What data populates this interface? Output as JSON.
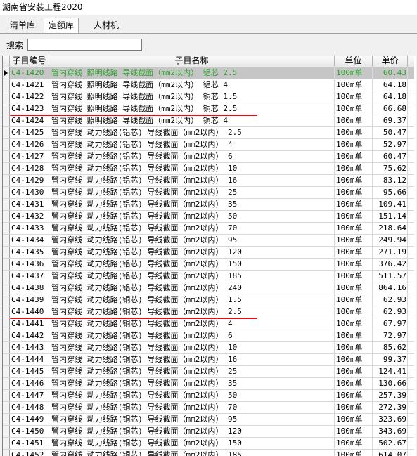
{
  "window": {
    "title": "湖南省安装工程2020"
  },
  "tabs": [
    {
      "label": "清单库",
      "active": false
    },
    {
      "label": "定额库",
      "active": true
    },
    {
      "label": "人材机",
      "active": false
    }
  ],
  "search": {
    "label": "搜索",
    "value": "",
    "placeholder": ""
  },
  "table": {
    "columns": [
      "子目编号",
      "子目名称",
      "单位",
      "单价"
    ],
    "selected_index": 0,
    "rows": [
      {
        "code": "C4-1420",
        "name": "管内穿线  照明线路  导线截面（mm2以内） 铝芯 2.5",
        "unit": "100m单",
        "price": "60.43"
      },
      {
        "code": "C4-1421",
        "name": "管内穿线  照明线路  导线截面（mm2以内） 铝芯 4",
        "unit": "100m单",
        "price": "64.18"
      },
      {
        "code": "C4-1422",
        "name": "管内穿线  照明线路  导线截面（mm2以内） 铜芯 1.5",
        "unit": "100m单",
        "price": "64.18"
      },
      {
        "code": "C4-1423",
        "name": "管内穿线  照明线路  导线截面（mm2以内） 铜芯 2.5",
        "unit": "100m单",
        "price": "66.68"
      },
      {
        "code": "C4-1424",
        "name": "管内穿线  照明线路  导线截面（mm2以内） 铜芯 4",
        "unit": "100m单",
        "price": "69.37"
      },
      {
        "code": "C4-1425",
        "name": "管内穿线  动力线路(铝芯) 导线截面（mm2以内） 2.5",
        "unit": "100m单",
        "price": "50.47"
      },
      {
        "code": "C4-1426",
        "name": "管内穿线  动力线路(铝芯) 导线截面（mm2以内） 4",
        "unit": "100m单",
        "price": "52.97"
      },
      {
        "code": "C4-1427",
        "name": "管内穿线  动力线路(铝芯) 导线截面（mm2以内） 6",
        "unit": "100m单",
        "price": "60.47"
      },
      {
        "code": "C4-1428",
        "name": "管内穿线  动力线路(铝芯) 导线截面（mm2以内） 10",
        "unit": "100m单",
        "price": "75.62"
      },
      {
        "code": "C4-1429",
        "name": "管内穿线  动力线路(铝芯) 导线截面（mm2以内） 16",
        "unit": "100m单",
        "price": "83.12"
      },
      {
        "code": "C4-1430",
        "name": "管内穿线  动力线路(铝芯) 导线截面（mm2以内） 25",
        "unit": "100m单",
        "price": "95.66"
      },
      {
        "code": "C4-1431",
        "name": "管内穿线  动力线路(铝芯) 导线截面（mm2以内） 35",
        "unit": "100m单",
        "price": "109.41"
      },
      {
        "code": "C4-1432",
        "name": "管内穿线  动力线路(铝芯) 导线截面（mm2以内） 50",
        "unit": "100m单",
        "price": "151.14"
      },
      {
        "code": "C4-1433",
        "name": "管内穿线  动力线路(铝芯) 导线截面（mm2以内） 70",
        "unit": "100m单",
        "price": "218.64"
      },
      {
        "code": "C4-1434",
        "name": "管内穿线  动力线路(铝芯) 导线截面（mm2以内） 95",
        "unit": "100m单",
        "price": "249.94"
      },
      {
        "code": "C4-1435",
        "name": "管内穿线  动力线路(铝芯) 导线截面（mm2以内） 120",
        "unit": "100m单",
        "price": "271.19"
      },
      {
        "code": "C4-1436",
        "name": "管内穿线  动力线路(铝芯) 导线截面（mm2以内） 150",
        "unit": "100m单",
        "price": "376.42"
      },
      {
        "code": "C4-1437",
        "name": "管内穿线  动力线路(铝芯) 导线截面（mm2以内） 185",
        "unit": "100m单",
        "price": "511.57"
      },
      {
        "code": "C4-1438",
        "name": "管内穿线  动力线路(铝芯) 导线截面（mm2以内） 240",
        "unit": "100m单",
        "price": "864.16"
      },
      {
        "code": "C4-1439",
        "name": "管内穿线  动力线路(铜芯) 导线截面（mm2以内） 1.5",
        "unit": "100m单",
        "price": "62.93"
      },
      {
        "code": "C4-1440",
        "name": "管内穿线  动力线路(铜芯) 导线截面（mm2以内） 2.5",
        "unit": "100m单",
        "price": "62.93"
      },
      {
        "code": "C4-1441",
        "name": "管内穿线  动力线路(铜芯) 导线截面（mm2以内） 4",
        "unit": "100m单",
        "price": "67.97"
      },
      {
        "code": "C4-1442",
        "name": "管内穿线  动力线路(铜芯) 导线截面（mm2以内） 6",
        "unit": "100m单",
        "price": "72.97"
      },
      {
        "code": "C4-1443",
        "name": "管内穿线  动力线路(铜芯) 导线截面（mm2以内） 10",
        "unit": "100m单",
        "price": "85.62"
      },
      {
        "code": "C4-1444",
        "name": "管内穿线  动力线路(铜芯) 导线截面（mm2以内） 16",
        "unit": "100m单",
        "price": "99.37"
      },
      {
        "code": "C4-1445",
        "name": "管内穿线  动力线路(铜芯) 导线截面（mm2以内） 25",
        "unit": "100m单",
        "price": "124.41"
      },
      {
        "code": "C4-1446",
        "name": "管内穿线  动力线路(铜芯) 导线截面（mm2以内） 35",
        "unit": "100m单",
        "price": "130.66"
      },
      {
        "code": "C4-1447",
        "name": "管内穿线  动力线路(铜芯) 导线截面（mm2以内） 50",
        "unit": "100m单",
        "price": "257.39"
      },
      {
        "code": "C4-1448",
        "name": "管内穿线  动力线路(铜芯) 导线截面（mm2以内） 70",
        "unit": "100m单",
        "price": "272.39"
      },
      {
        "code": "C4-1449",
        "name": "管内穿线  动力线路(铜芯) 导线截面（mm2以内） 95",
        "unit": "100m单",
        "price": "323.69"
      },
      {
        "code": "C4-1450",
        "name": "管内穿线  动力线路(铜芯) 导线截面（mm2以内） 120",
        "unit": "100m单",
        "price": "343.69"
      },
      {
        "code": "C4-1451",
        "name": "管内穿线  动力线路(铜芯) 导线截面（mm2以内） 150",
        "unit": "100m单",
        "price": "502.67"
      },
      {
        "code": "C4-1452",
        "name": "管内穿线  动力线路(铜芯) 导线截面（mm2以内） 185",
        "unit": "100m单",
        "price": "614.07"
      }
    ]
  },
  "annotations": {
    "underline_color": "#e0101a",
    "underlined_rows": [
      3,
      20
    ]
  },
  "colors": {
    "selected_text": "#2ea22e",
    "selected_bg": "#c6c6c6"
  }
}
